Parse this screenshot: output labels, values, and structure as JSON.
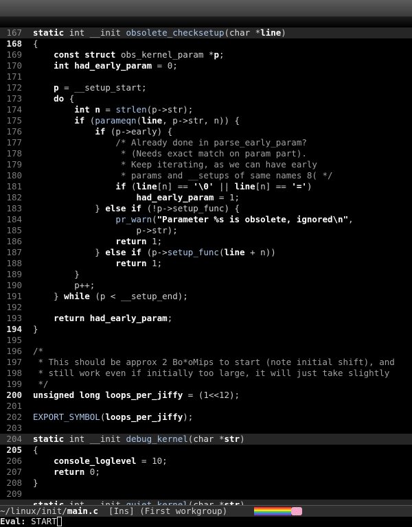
{
  "lines": [
    {
      "n": "167",
      "hl": true,
      "bold": false,
      "t": [
        [
          "k",
          "static"
        ],
        [
          "p",
          " "
        ],
        [
          "t",
          "int"
        ],
        [
          "p",
          " __init "
        ],
        [
          "f",
          "obsolete_checksetup"
        ],
        [
          "p",
          "("
        ],
        [
          "t",
          "char"
        ],
        [
          "p",
          " *"
        ],
        [
          "s",
          "line"
        ],
        [
          "p",
          ")"
        ]
      ]
    },
    {
      "n": "168",
      "hl": false,
      "bold": true,
      "t": [
        [
          "p",
          "{"
        ]
      ]
    },
    {
      "n": "169",
      "hl": false,
      "bold": false,
      "t": [
        [
          "p",
          "    "
        ],
        [
          "s",
          "const"
        ],
        [
          "p",
          " "
        ],
        [
          "s",
          "struct"
        ],
        [
          "p",
          " obs_kernel_param *"
        ],
        [
          "s",
          "p"
        ],
        [
          "p",
          ";"
        ]
      ]
    },
    {
      "n": "170",
      "hl": false,
      "bold": false,
      "t": [
        [
          "p",
          "    "
        ],
        [
          "s",
          "int"
        ],
        [
          "p",
          " "
        ],
        [
          "s",
          "had_early_param"
        ],
        [
          "p",
          " = "
        ],
        [
          "n",
          "0"
        ],
        [
          "p",
          ";"
        ]
      ]
    },
    {
      "n": "171",
      "hl": false,
      "bold": false,
      "t": []
    },
    {
      "n": "172",
      "hl": false,
      "bold": false,
      "t": [
        [
          "p",
          "    "
        ],
        [
          "s",
          "p"
        ],
        [
          "p",
          " = __setup_start;"
        ]
      ]
    },
    {
      "n": "173",
      "hl": false,
      "bold": false,
      "t": [
        [
          "p",
          "    "
        ],
        [
          "s",
          "do"
        ],
        [
          "p",
          " {"
        ]
      ]
    },
    {
      "n": "174",
      "hl": false,
      "bold": false,
      "t": [
        [
          "p",
          "        "
        ],
        [
          "s",
          "int"
        ],
        [
          "p",
          " "
        ],
        [
          "s",
          "n"
        ],
        [
          "p",
          " = "
        ],
        [
          "f",
          "strlen"
        ],
        [
          "p",
          "(p->str);"
        ]
      ]
    },
    {
      "n": "175",
      "hl": false,
      "bold": false,
      "t": [
        [
          "p",
          "        "
        ],
        [
          "s",
          "if"
        ],
        [
          "p",
          " ("
        ],
        [
          "f",
          "parameqn"
        ],
        [
          "p",
          "("
        ],
        [
          "s",
          "line"
        ],
        [
          "p",
          ", p->str, n)) {"
        ]
      ]
    },
    {
      "n": "176",
      "hl": false,
      "bold": false,
      "t": [
        [
          "p",
          "            "
        ],
        [
          "s",
          "if"
        ],
        [
          "p",
          " (p->early) {"
        ]
      ]
    },
    {
      "n": "177",
      "hl": false,
      "bold": false,
      "t": [
        [
          "p",
          "                "
        ],
        [
          "c",
          "/* Already done in parse_early_param?"
        ]
      ]
    },
    {
      "n": "178",
      "hl": false,
      "bold": false,
      "t": [
        [
          "p",
          "                "
        ],
        [
          "c",
          " * (Needs exact match on param part)."
        ]
      ]
    },
    {
      "n": "179",
      "hl": false,
      "bold": false,
      "t": [
        [
          "p",
          "                "
        ],
        [
          "c",
          " * Keep iterating, as we can have early"
        ]
      ]
    },
    {
      "n": "180",
      "hl": false,
      "bold": false,
      "t": [
        [
          "p",
          "                "
        ],
        [
          "c",
          " * params and __setups of same names 8( */"
        ]
      ]
    },
    {
      "n": "181",
      "hl": false,
      "bold": false,
      "t": [
        [
          "p",
          "                "
        ],
        [
          "s",
          "if"
        ],
        [
          "p",
          " ("
        ],
        [
          "s",
          "line"
        ],
        [
          "p",
          "[n] == "
        ],
        [
          "s",
          "'\\0'"
        ],
        [
          "p",
          " || "
        ],
        [
          "s",
          "line"
        ],
        [
          "p",
          "[n] == "
        ],
        [
          "s",
          "'='"
        ],
        [
          "p",
          ")"
        ]
      ]
    },
    {
      "n": "182",
      "hl": false,
      "bold": false,
      "t": [
        [
          "p",
          "                    "
        ],
        [
          "s",
          "had_early_param"
        ],
        [
          "p",
          " = "
        ],
        [
          "n",
          "1"
        ],
        [
          "p",
          ";"
        ]
      ]
    },
    {
      "n": "183",
      "hl": false,
      "bold": false,
      "t": [
        [
          "p",
          "            } "
        ],
        [
          "s",
          "else if"
        ],
        [
          "p",
          " (!p->setup_func) {"
        ]
      ]
    },
    {
      "n": "184",
      "hl": false,
      "bold": false,
      "t": [
        [
          "p",
          "                "
        ],
        [
          "f",
          "pr_warn"
        ],
        [
          "p",
          "("
        ],
        [
          "s",
          "\"Parameter %s is obsolete, ignored\\n\""
        ],
        [
          "p",
          ","
        ]
      ]
    },
    {
      "n": "185",
      "hl": false,
      "bold": false,
      "t": [
        [
          "p",
          "                    p->str);"
        ]
      ]
    },
    {
      "n": "186",
      "hl": false,
      "bold": false,
      "t": [
        [
          "p",
          "                "
        ],
        [
          "s",
          "return"
        ],
        [
          "p",
          " "
        ],
        [
          "n",
          "1"
        ],
        [
          "p",
          ";"
        ]
      ]
    },
    {
      "n": "187",
      "hl": false,
      "bold": false,
      "t": [
        [
          "p",
          "            } "
        ],
        [
          "s",
          "else if"
        ],
        [
          "p",
          " (p->"
        ],
        [
          "f",
          "setup_func"
        ],
        [
          "p",
          "("
        ],
        [
          "s",
          "line"
        ],
        [
          "p",
          " + n))"
        ]
      ]
    },
    {
      "n": "188",
      "hl": false,
      "bold": false,
      "t": [
        [
          "p",
          "                "
        ],
        [
          "s",
          "return"
        ],
        [
          "p",
          " "
        ],
        [
          "n",
          "1"
        ],
        [
          "p",
          ";"
        ]
      ]
    },
    {
      "n": "189",
      "hl": false,
      "bold": false,
      "t": [
        [
          "p",
          "        }"
        ]
      ]
    },
    {
      "n": "190",
      "hl": false,
      "bold": false,
      "t": [
        [
          "p",
          "        p++;"
        ]
      ]
    },
    {
      "n": "191",
      "hl": false,
      "bold": false,
      "t": [
        [
          "p",
          "    } "
        ],
        [
          "s",
          "while"
        ],
        [
          "p",
          " (p < __setup_end);"
        ]
      ]
    },
    {
      "n": "192",
      "hl": false,
      "bold": false,
      "t": []
    },
    {
      "n": "193",
      "hl": false,
      "bold": false,
      "t": [
        [
          "p",
          "    "
        ],
        [
          "s",
          "return"
        ],
        [
          "p",
          " "
        ],
        [
          "s",
          "had_early_param"
        ],
        [
          "p",
          ";"
        ]
      ]
    },
    {
      "n": "194",
      "hl": false,
      "bold": true,
      "t": [
        [
          "p",
          "}"
        ]
      ]
    },
    {
      "n": "195",
      "hl": false,
      "bold": false,
      "t": []
    },
    {
      "n": "196",
      "hl": false,
      "bold": false,
      "t": [
        [
          "c",
          "/*"
        ]
      ]
    },
    {
      "n": "197",
      "hl": false,
      "bold": false,
      "t": [
        [
          "c",
          " * This should be approx 2 Bo*oMips to start (note initial shift), and"
        ]
      ]
    },
    {
      "n": "198",
      "hl": false,
      "bold": false,
      "t": [
        [
          "c",
          " * still work even if initially too large, it will just take slightly"
        ]
      ]
    },
    {
      "n": "199",
      "hl": false,
      "bold": false,
      "t": [
        [
          "c",
          " */"
        ]
      ]
    },
    {
      "n": "200",
      "hl": false,
      "bold": true,
      "t": [
        [
          "s",
          "unsigned long"
        ],
        [
          "p",
          " "
        ],
        [
          "s",
          "loops_per_jiffy"
        ],
        [
          "p",
          " = ("
        ],
        [
          "n",
          "1"
        ],
        [
          "p",
          "<<"
        ],
        [
          "n",
          "12"
        ],
        [
          "p",
          ");"
        ]
      ]
    },
    {
      "n": "201",
      "hl": false,
      "bold": false,
      "t": []
    },
    {
      "n": "202",
      "hl": false,
      "bold": false,
      "t": [
        [
          "f",
          "EXPORT_SYMBOL"
        ],
        [
          "p",
          "("
        ],
        [
          "s",
          "loops_per_jiffy"
        ],
        [
          "p",
          ");"
        ]
      ]
    },
    {
      "n": "203",
      "hl": false,
      "bold": false,
      "t": []
    },
    {
      "n": "204",
      "hl": true,
      "bold": false,
      "t": [
        [
          "k",
          "static"
        ],
        [
          "p",
          " "
        ],
        [
          "t",
          "int"
        ],
        [
          "p",
          " __init "
        ],
        [
          "f",
          "debug_kernel"
        ],
        [
          "p",
          "("
        ],
        [
          "t",
          "char"
        ],
        [
          "p",
          " *"
        ],
        [
          "s",
          "str"
        ],
        [
          "p",
          ")"
        ]
      ]
    },
    {
      "n": "205",
      "hl": false,
      "bold": true,
      "t": [
        [
          "p",
          "{"
        ]
      ]
    },
    {
      "n": "206",
      "hl": false,
      "bold": false,
      "t": [
        [
          "p",
          "    "
        ],
        [
          "s",
          "console_loglevel"
        ],
        [
          "p",
          " = "
        ],
        [
          "n",
          "10"
        ],
        [
          "p",
          ";"
        ]
      ]
    },
    {
      "n": "207",
      "hl": false,
      "bold": false,
      "t": [
        [
          "p",
          "    "
        ],
        [
          "s",
          "return"
        ],
        [
          "p",
          " "
        ],
        [
          "n",
          "0"
        ],
        [
          "p",
          ";"
        ]
      ]
    },
    {
      "n": "208",
      "hl": false,
      "bold": false,
      "t": [
        [
          "p",
          "}"
        ]
      ]
    },
    {
      "n": "209",
      "hl": false,
      "bold": false,
      "t": []
    },
    {
      "n": "",
      "hl": true,
      "bold": false,
      "t": [
        [
          "k",
          "static"
        ],
        [
          "p",
          " "
        ],
        [
          "t",
          "int"
        ],
        [
          "p",
          " __init "
        ],
        [
          "f",
          "quiet_kernel"
        ],
        [
          "p",
          "("
        ],
        [
          "t",
          "char"
        ],
        [
          "p",
          " *"
        ],
        [
          "s",
          "str"
        ],
        [
          "p",
          ")"
        ]
      ]
    }
  ],
  "modeline": {
    "file_dir": "~/linux/init/",
    "file_name": "main.c",
    "mode_text": "  [Ins] (First workgroup)"
  },
  "minibuffer": {
    "label": "Eval: ",
    "text": "START"
  },
  "colors": {
    "background": "#000000",
    "highlight_line": "#262626",
    "keyword": "#ffffff",
    "function": "#a8c4e8",
    "comment": "#a0a0a0"
  }
}
